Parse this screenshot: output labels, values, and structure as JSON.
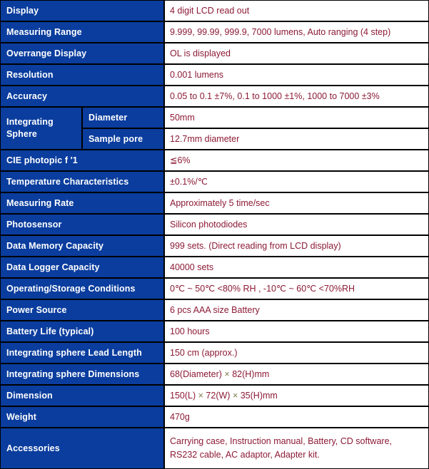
{
  "table": {
    "rows": [
      {
        "label": "Display",
        "value": "4 digit LCD read out"
      },
      {
        "label": "Measuring Range",
        "value": "9.999, 99.99, 999.9, 7000 lumens, Auto ranging (4 step)"
      },
      {
        "label": "Overrange Display",
        "value": "OL is displayed"
      },
      {
        "label": "Resolution",
        "value": "0.001 lumens"
      },
      {
        "label": "Accuracy",
        "value": "0.05 to 0.1 ±7%, 0.1 to 1000 ±1%, 1000 to 7000 ±3%"
      }
    ],
    "sphere": {
      "group_label": "Integrating Sphere",
      "sub_rows": [
        {
          "label": "Diameter",
          "value": "50mm"
        },
        {
          "label": "Sample pore",
          "value": "12.7mm diameter"
        }
      ]
    },
    "rows2": [
      {
        "label": "CIE photopic f ′1",
        "value": "≦6%"
      },
      {
        "label": "Temperature Characteristics",
        "value": "±0.1%/℃"
      },
      {
        "label": "Measuring Rate",
        "value": "Approximately 5 time/sec"
      },
      {
        "label": "Photosensor",
        "value": "Silicon photodiodes"
      },
      {
        "label": "Data Memory Capacity",
        "value": "999 sets. (Direct reading from LCD display)"
      },
      {
        "label": "Data Logger Capacity",
        "value": "40000 sets"
      },
      {
        "label": "Operating/Storage Conditions",
        "value": "0℃ ~ 50℃ <80% RH , -10℃ ~ 60℃ <70%RH"
      },
      {
        "label": "Power Source",
        "value": "6 pcs AAA size Battery"
      },
      {
        "label": "Battery Life (typical)",
        "value": "100 hours"
      },
      {
        "label": "Integrating sphere Lead Length",
        "value": "150 cm (approx.)"
      }
    ],
    "sphere_dimensions": {
      "label": "Integrating sphere Dimensions",
      "part1": "68(Diameter)",
      "mult1": "×",
      "part2": "82(H)mm"
    },
    "dimension": {
      "label": "Dimension",
      "part1": "150(L)",
      "mult1": "×",
      "part2": "72(W)",
      "mult2": "×",
      "part3": "35(H)mm"
    },
    "weight": {
      "label": "Weight",
      "value": "470g"
    },
    "accessories": {
      "label": "Accessories",
      "line1": "Carrying case, Instruction manual, Battery, CD software,",
      "line2": "RS232 cable, AC adaptor, Adapter kit."
    }
  },
  "colors": {
    "label_background": "#0a3d9e",
    "label_text": "#ffffff",
    "value_text": "#8c1a35",
    "border": "#000000",
    "multiply_sign": "#7d7d4e"
  }
}
